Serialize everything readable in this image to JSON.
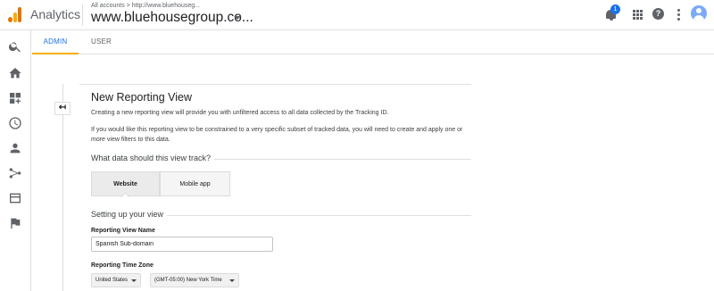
{
  "header": {
    "app_name": "Analytics",
    "breadcrumb": "All accounts > http://www.bluehouseg...",
    "property_name": "www.bluehousegroup.co...",
    "notification_count": "1",
    "help_glyph": "?"
  },
  "tabs": [
    {
      "label": "ADMIN",
      "active": true
    },
    {
      "label": "USER",
      "active": false
    }
  ],
  "rail_icons": [
    "search-icon",
    "home-icon",
    "customization-icon",
    "realtime-clock-icon",
    "audience-person-icon",
    "acquisition-icon",
    "behavior-icon",
    "conversions-flag-icon"
  ],
  "back_glyph": "↤",
  "form": {
    "title": "New Reporting View",
    "intro": "Creating a new reporting view will provide you with unfiltered access to all data collected by the Tracking ID.",
    "detail": "If you would like this reporting view to be constrained to a very specific subset of tracked data, you will need to create and apply one or more view filters to this data.",
    "track_heading": "What data should this view track?",
    "track_options": [
      "Website",
      "Mobile app"
    ],
    "track_selected": "Website",
    "setup_heading": "Setting up your view",
    "name_label": "Reporting View Name",
    "name_value": "Spanish Sub-domain",
    "timezone_label": "Reporting Time Zone",
    "country_value": "United States",
    "timezone_value": "(GMT-05:00) New York Time"
  },
  "colors": {
    "accent": "#1a73e8",
    "tab_underline": "#f9ab00",
    "logo_orange": "#e37400"
  }
}
